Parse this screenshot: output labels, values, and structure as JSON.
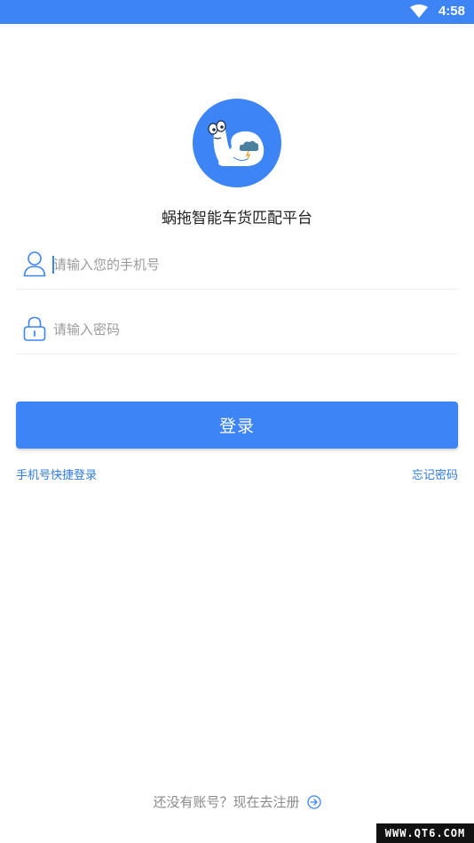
{
  "status_bar": {
    "time": "4:58",
    "icons": [
      "wifi-icon"
    ],
    "color": "#3d84f7"
  },
  "app": {
    "name": "蜗拖智能车货匹配平台",
    "logo_icon": "snail-logo-icon",
    "accent": "#3d84f7"
  },
  "form": {
    "phone_placeholder": "请输入您的手机号",
    "phone_icon": "user-icon",
    "password_placeholder": "请输入密码",
    "password_icon": "lock-icon"
  },
  "actions": {
    "login_label": "登录",
    "quick_login_label": "手机号快捷登录",
    "forgot_password_label": "忘记密码"
  },
  "footer": {
    "register_label": "还没有账号？现在去注册",
    "register_icon": "arrow-right-circle-icon",
    "watermark": "WWW.QT6.COM"
  }
}
